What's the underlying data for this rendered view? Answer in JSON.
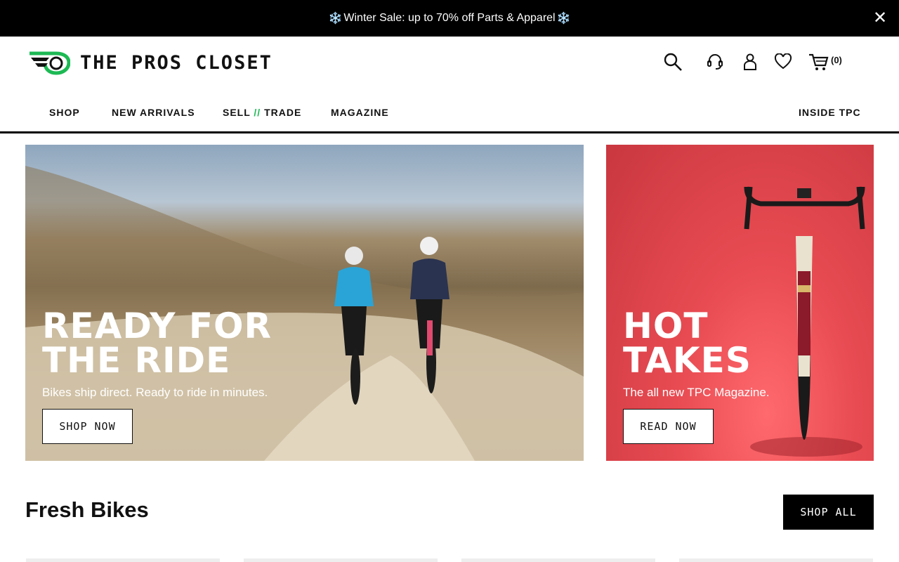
{
  "promo": {
    "snow_icon": "❄️",
    "text": "Winter Sale: up to 70% off Parts & Apparel",
    "close_glyph": "✕"
  },
  "brand": {
    "name": "THE PROS CLOSET",
    "accent": "#1db954"
  },
  "header_icons": [
    "search-icon",
    "support-headset-icon",
    "account-icon",
    "wishlist-heart-icon",
    "cart-icon"
  ],
  "cart": {
    "count_text": "(0)"
  },
  "nav": {
    "shop": "SHOP",
    "new_arrivals": "NEW ARRIVALS",
    "sell": "SELL",
    "slashes": "//",
    "trade": "TRADE",
    "magazine": "MAGAZINE",
    "inside_tpc": "INSIDE TPC"
  },
  "hero_left": {
    "title_line1": "READY FOR",
    "title_line2": "THE RIDE",
    "subtitle": "Bikes ship direct. Ready to ride in minutes.",
    "cta": "SHOP NOW"
  },
  "hero_right": {
    "title_line1": "HOT",
    "title_line2": "TAKES",
    "subtitle": "The all new TPC Magazine.",
    "cta": "READ NOW"
  },
  "fresh_bikes": {
    "title": "Fresh Bikes",
    "cta": "SHOP ALL"
  }
}
